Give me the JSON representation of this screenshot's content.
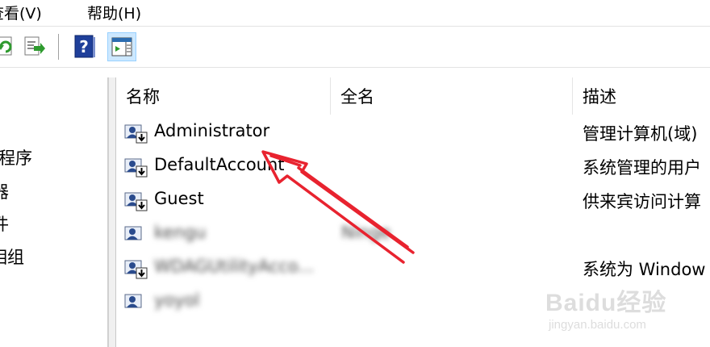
{
  "menubar": {
    "items": [
      {
        "label": "查看(V)"
      },
      {
        "label": "帮助(H)"
      }
    ]
  },
  "toolbar": {
    "buttons": [
      {
        "icon": "refresh-icon"
      },
      {
        "icon": "export-list-icon"
      },
      {
        "icon": "help-icon"
      },
      {
        "icon": "action-pane-icon"
      }
    ]
  },
  "left_pane": {
    "items": [
      {
        "label": "程序"
      },
      {
        "label": "器"
      },
      {
        "label": "件"
      },
      {
        "label": "相组"
      }
    ]
  },
  "columns": [
    {
      "label": "名称"
    },
    {
      "label": "全名"
    },
    {
      "label": "描述"
    }
  ],
  "users": [
    {
      "name": "Administrator",
      "full_name": "",
      "description": "管理计算机(域)",
      "blurred": false
    },
    {
      "name": "DefaultAccount",
      "full_name": "",
      "description": "系统管理的用户",
      "blurred": false
    },
    {
      "name": "Guest",
      "full_name": "",
      "description": "供来宾访问计算",
      "blurred": false
    },
    {
      "name": "kengu",
      "full_name": "Ninge",
      "description": "",
      "blurred": true
    },
    {
      "name": "WDAGUtilityAcco...",
      "full_name": "",
      "description": "系统为 Window",
      "blurred": true
    },
    {
      "name": "yoyol",
      "full_name": "",
      "description": "",
      "blurred": true
    }
  ],
  "watermark": {
    "brand": "Baidu经验",
    "url": "jingyan.baidu.com"
  },
  "colors": {
    "arrow": "#e8232f",
    "help_icon": "#1f3f9a",
    "active_button": "#cce8ff"
  }
}
